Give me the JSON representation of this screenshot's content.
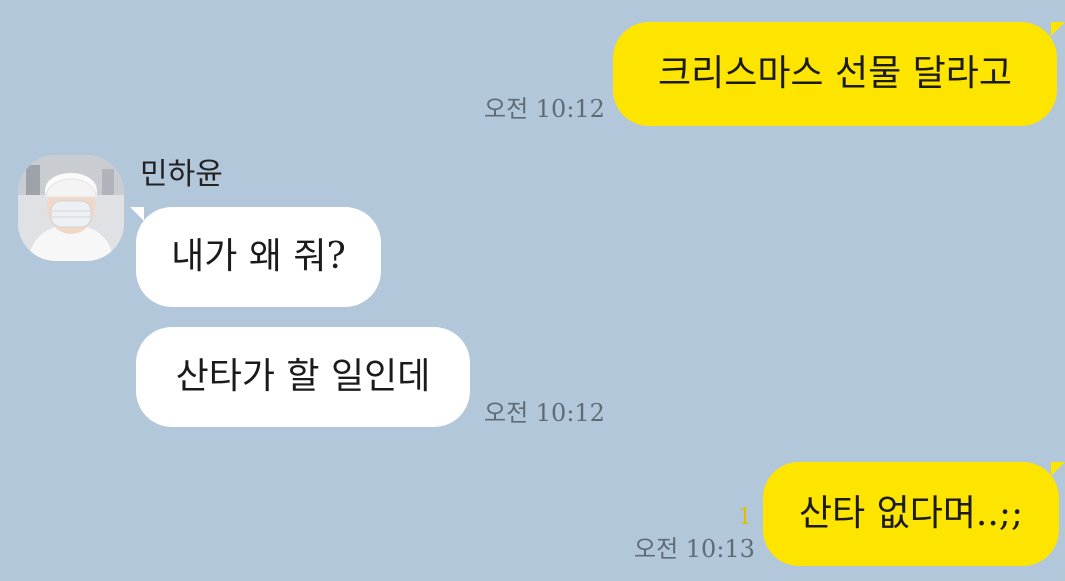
{
  "chat": {
    "background": "#b2c7da",
    "my_bubble_color": "#fee500",
    "their_bubble_color": "#ffffff",
    "messages": [
      {
        "from": "me",
        "text": "크리스마스 선물 달라고",
        "time": "오전 10:12"
      },
      {
        "from": "other",
        "sender": "민하윤",
        "text": "내가 왜 줘?"
      },
      {
        "from": "other",
        "text": "산타가 할 일인데",
        "time": "오전 10:12"
      },
      {
        "from": "me",
        "text": "산타 없다며..;;",
        "time": "오전 10:13",
        "unread_count": "1"
      }
    ]
  },
  "contact": {
    "name": "민하윤",
    "avatar_icon": "profile-photo-person-white-beanie-mask"
  }
}
